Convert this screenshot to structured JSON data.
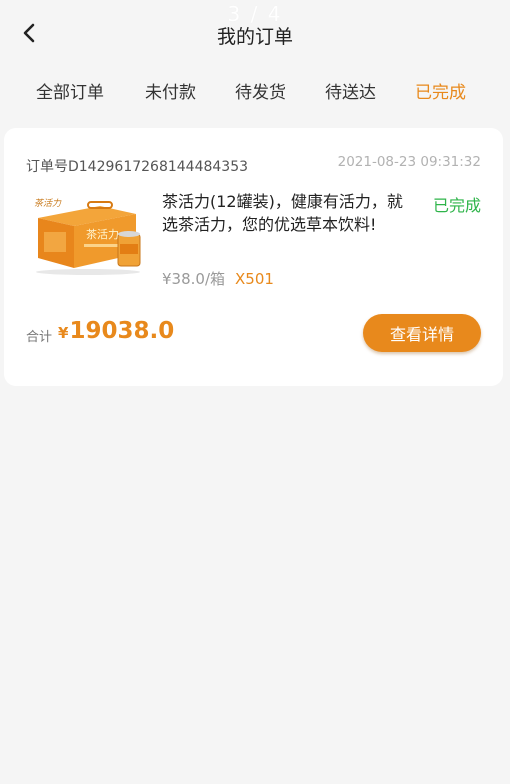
{
  "header": {
    "page_indicator": "3 / 4",
    "title": "我的订单"
  },
  "tabs": [
    {
      "label": "全部订单"
    },
    {
      "label": "未付款"
    },
    {
      "label": "待发货"
    },
    {
      "label": "待送达"
    },
    {
      "label": "已完成"
    }
  ],
  "active_tab": "已完成",
  "order": {
    "order_no": "订单号D1429617268144484353",
    "time": "2021-08-23 09:31:32",
    "product_name": "茶活力(12罐装)，健康有活力，就选茶活力，您的优选草本饮料!",
    "product_brand": "茶活力",
    "status": "已完成",
    "price": "¥38.0/箱",
    "quantity": "X501",
    "total_label": "合计",
    "total_currency": "¥",
    "total_value": "19038.0",
    "detail_button": "查看详情"
  },
  "colors": {
    "accent": "#e8891c",
    "status_done": "#2fb44a"
  }
}
